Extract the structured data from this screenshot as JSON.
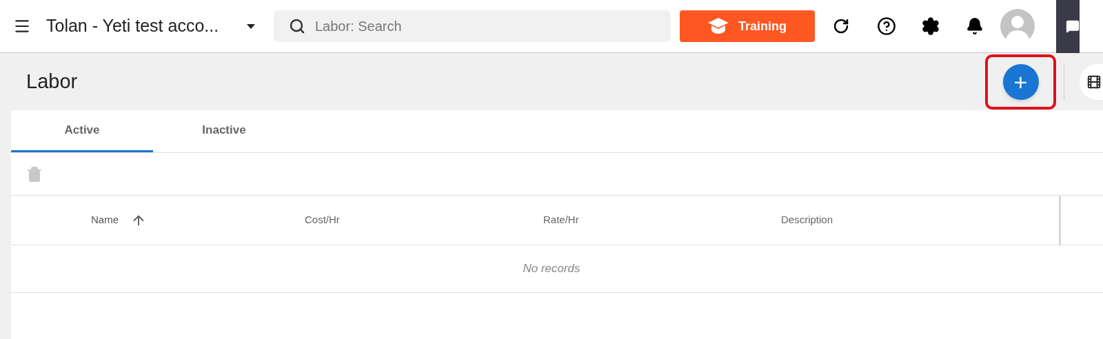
{
  "header": {
    "account_name": "Tolan - Yeti test acco...",
    "search": {
      "placeholder": "Labor: Search"
    },
    "training_button": "Training"
  },
  "page": {
    "title": "Labor",
    "add_button": {
      "label": "+",
      "highlighted": true
    }
  },
  "tabs": [
    {
      "label": "Active",
      "selected": true
    },
    {
      "label": "Inactive",
      "selected": false
    }
  ],
  "toolbar": {
    "delete_disabled": true
  },
  "table": {
    "columns": [
      {
        "label": "Name",
        "sorted": true
      },
      {
        "label": "Cost/Hr",
        "sorted": false
      },
      {
        "label": "Rate/Hr",
        "sorted": false
      },
      {
        "label": "Description",
        "sorted": false
      }
    ],
    "empty_message": "No records"
  }
}
